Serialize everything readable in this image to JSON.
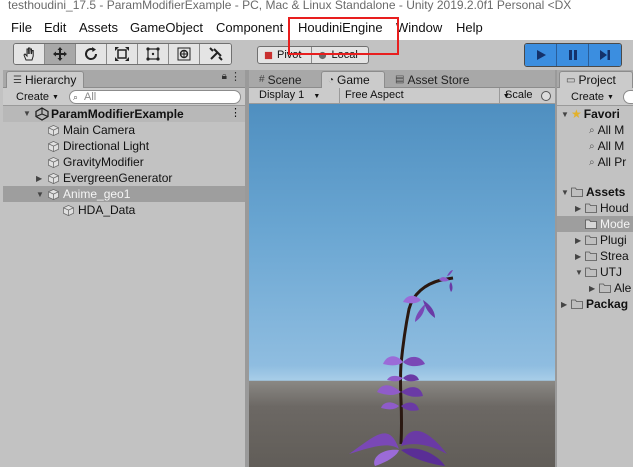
{
  "window": {
    "title": "testhoudini_17.5 - ParamModifierExample - PC, Mac & Linux Standalone - Unity 2019.2.0f1 Personal <DX"
  },
  "menu": {
    "items": [
      "File",
      "Edit",
      "Assets",
      "GameObject",
      "Component",
      "HoudiniEngine",
      "Window",
      "Help"
    ]
  },
  "toolbar": {
    "tools": [
      "hand-tool-icon",
      "move-tool-icon",
      "rotate-tool-icon",
      "scale-tool-icon",
      "rect-tool-icon",
      "transform-tool-icon",
      "custom-tool-icon"
    ],
    "pivot_label": "Pivot",
    "local_label": "Local"
  },
  "hierarchy": {
    "tab_label": "Hierarchy",
    "create_label": "Create",
    "search_placeholder": "All",
    "scene_name": "ParamModifierExample",
    "items": [
      {
        "label": "Main Camera"
      },
      {
        "label": "Directional Light"
      },
      {
        "label": "GravityModifier"
      },
      {
        "label": "EvergreenGenerator"
      },
      {
        "label": "Anime_geo1"
      },
      {
        "label": "HDA_Data"
      }
    ]
  },
  "game": {
    "tabs": [
      "Scene",
      "Game",
      "Asset Store"
    ],
    "display_label": "Display 1",
    "aspect_label": "Free Aspect",
    "scale_label": "Scale"
  },
  "project": {
    "tab_label": "Project",
    "create_label": "Create",
    "favorites_label": "Favori",
    "favorites": [
      "All M",
      "All M",
      "All Pr"
    ],
    "assets_label": "Assets",
    "assets": [
      "Houd",
      "Mode",
      "Plugi",
      "Strea",
      "UTJ",
      "Ale"
    ],
    "packages_label": "Packag"
  },
  "colors": {
    "highlight": "#e81e1e",
    "play_accent": "#3b8ee0",
    "petal": "#8f5cc9"
  }
}
